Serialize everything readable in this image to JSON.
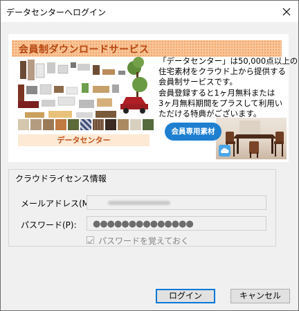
{
  "window": {
    "title": "データセンターへログイン"
  },
  "banner": {
    "headline": "会員制ダウンロードサービス",
    "description": [
      "「データセンター」は50,000点以上の",
      "住宅素材をクラウド上から提供する",
      "会員制サービスです。",
      "会員登録すると1ヶ月無料または",
      "3ヶ月無料期間をプラスして利用い",
      "ただける特典がございます。"
    ],
    "catalog_label": "データセンター",
    "badge": "会員専用素材"
  },
  "license": {
    "group_title": "クラウドライセンス情報",
    "email_label": "メールアドレス(M):",
    "email_value": "",
    "password_label": "パスワード(P):",
    "password_value": "●●●●●●●●●●●●●●",
    "remember_label": "パスワードを覚えておく",
    "remember_checked": true
  },
  "buttons": {
    "login": "ログイン",
    "cancel": "キャンセル"
  }
}
